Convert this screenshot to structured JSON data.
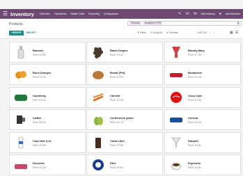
{
  "app": {
    "title": "Inventory",
    "menu": [
      "Overview",
      "Operations",
      "Master Data",
      "Reporting",
      "Configuration"
    ],
    "company": "MyCompany",
    "user": "Administrator"
  },
  "control_panel": {
    "breadcrumb": "Products",
    "facets": [
      "Products",
      "Available in POS"
    ],
    "create_label": "CREATE",
    "import_label": "IMPORT",
    "filters_label": "Filters",
    "group_by_label": "Group By",
    "favorites_label": "Favorites",
    "pager": "1-80 / 157"
  },
  "products": [
    {
      "name": "Bacardi",
      "price": "Price: $ 5.50",
      "icon": "bottle-icon"
    },
    {
      "name": "Black Grapes",
      "price": "Price: $ 3.30",
      "icon": "grapes-icon"
    },
    {
      "name": "Bloody Mary",
      "price": "Price: $ 7.90",
      "icon": "cocktail-icon"
    },
    {
      "name": "Boni Oranges",
      "price": "Price: $ 1.50",
      "icon": "oranges-icon"
    },
    {
      "name": "Bread (Pnt)",
      "price": "Price: $ 2.50",
      "icon": "bread-icon"
    },
    {
      "name": "Budweiser",
      "price": "Price: $ 2.40",
      "icon": "budweiser-icon"
    },
    {
      "name": "Carlsberg",
      "price": "Price: $ 2.50",
      "icon": "carlsberg-icon"
    },
    {
      "name": "Carrots",
      "price": "Price: $ 0.80",
      "icon": "carrots-icon"
    },
    {
      "name": "Coca Cola",
      "price": "Price: $ 1.90",
      "icon": "coca-cola-icon"
    },
    {
      "name": "Coffee",
      "price": "Price: $ 4.30",
      "icon": "coffee-icon"
    },
    {
      "name": "Conference pears",
      "price": "Price: $ 1.70",
      "icon": "pears-icon"
    },
    {
      "name": "Corona",
      "price": "Price: $ 2.80",
      "icon": "corona-icon"
    },
    {
      "name": "Cow milk (Ltr)",
      "price": "Price: $ 0.80",
      "icon": "milk-icon"
    },
    {
      "name": "Cuba Libre",
      "price": "Price: $ 7.80",
      "icon": "cuba-libre-icon"
    },
    {
      "name": "Daiquiri",
      "price": "Price: $ 5.90",
      "icon": "daiquiri-icon"
    },
    {
      "name": "Desserts",
      "price": "Price: $ 3.50",
      "icon": "dessert-icon"
    },
    {
      "name": "Efes",
      "price": "Price: $ 2.60",
      "icon": "efes-icon"
    },
    {
      "name": "Espresso",
      "price": "Price: $ 4.90",
      "icon": "espresso-icon"
    }
  ],
  "colors": {
    "navbar": "#6e4a73",
    "primary_button": "#1f8a84"
  }
}
